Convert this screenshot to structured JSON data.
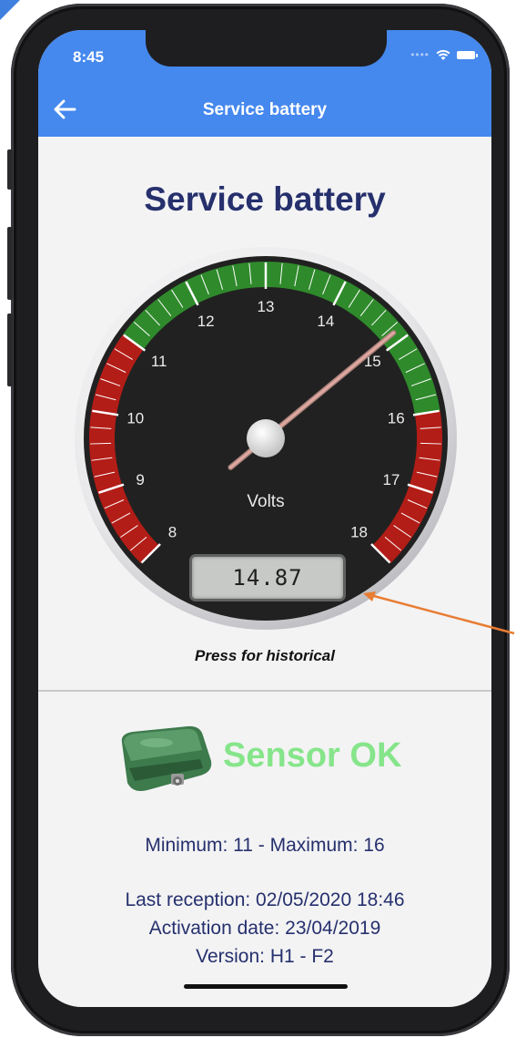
{
  "status_bar": {
    "time": "8:45"
  },
  "header": {
    "title": "Service battery"
  },
  "page": {
    "title": "Service battery"
  },
  "gauge": {
    "unit_label": "Volts",
    "ticks": [
      "8",
      "9",
      "10",
      "11",
      "12",
      "13",
      "14",
      "15",
      "16",
      "17",
      "18"
    ],
    "min": 8,
    "max": 18,
    "value": 14.87,
    "readout": "14.87",
    "hint": "Press for historical",
    "colors": {
      "ok": "#2f8a2b",
      "alarm": "#b31d17",
      "needle": "#e0a8a0"
    }
  },
  "sensor": {
    "status": "Sensor OK",
    "status_color": "#86e58a",
    "icon": "sensor-device-icon"
  },
  "info": {
    "range": "Minimum: 11 - Maximum: 16",
    "last_reception": "Last reception: 02/05/2020 18:46",
    "activation": "Activation date: 23/04/2019",
    "version": "Version: H1 - F2"
  },
  "colors": {
    "header": "#4588ee",
    "title": "#26306d",
    "arrow": "#e87d33"
  }
}
